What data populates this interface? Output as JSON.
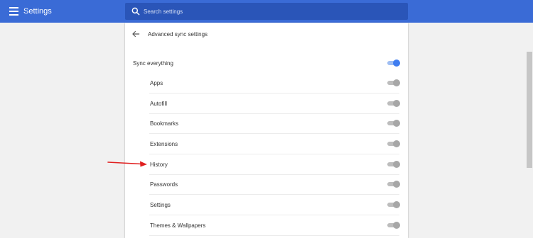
{
  "topbar": {
    "menu_icon": "hamburger-menu-icon",
    "title": "Settings",
    "search": {
      "placeholder": "Search settings",
      "value": ""
    }
  },
  "card": {
    "title": "Advanced sync settings",
    "back_icon": "back-arrow-icon",
    "sync_everything": {
      "label": "Sync everything",
      "enabled": true
    },
    "items": [
      {
        "label": "Apps",
        "enabled": false
      },
      {
        "label": "Autofill",
        "enabled": false
      },
      {
        "label": "Bookmarks",
        "enabled": false
      },
      {
        "label": "Extensions",
        "enabled": false
      },
      {
        "label": "History",
        "enabled": false
      },
      {
        "label": "Passwords",
        "enabled": false
      },
      {
        "label": "Settings",
        "enabled": false
      },
      {
        "label": "Themes & Wallpapers",
        "enabled": false
      }
    ]
  },
  "annotation": {
    "icon": "red-arrow-icon",
    "color": "#e02020"
  },
  "colors": {
    "accent": "#3a6bd6",
    "toggle_on": "#3f7df0",
    "toggle_off": "#a7a7a7"
  }
}
